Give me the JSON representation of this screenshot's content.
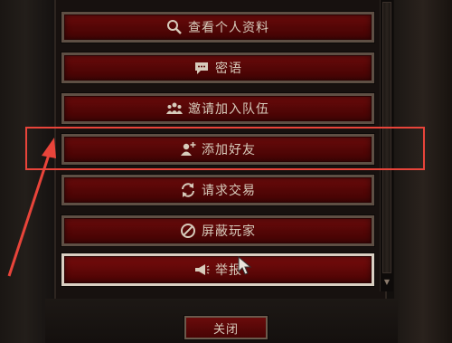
{
  "menu": {
    "items": [
      {
        "label": "查看个人资料",
        "icon": "magnifier-icon"
      },
      {
        "label": "密语",
        "icon": "chat-bubble-icon"
      },
      {
        "label": "邀请加入队伍",
        "icon": "group-icon"
      },
      {
        "label": "添加好友",
        "icon": "add-friend-icon"
      },
      {
        "label": "请求交易",
        "icon": "trade-arrows-icon"
      },
      {
        "label": "屏蔽玩家",
        "icon": "block-icon"
      },
      {
        "label": "举报",
        "icon": "megaphone-icon"
      }
    ]
  },
  "footer": {
    "close_label": "关闭"
  },
  "annotation": {
    "highlight_color": "#e8443a"
  },
  "colors": {
    "button_red": "#5a0707",
    "text": "#d7cbbb",
    "frame": "#5e4f44"
  }
}
